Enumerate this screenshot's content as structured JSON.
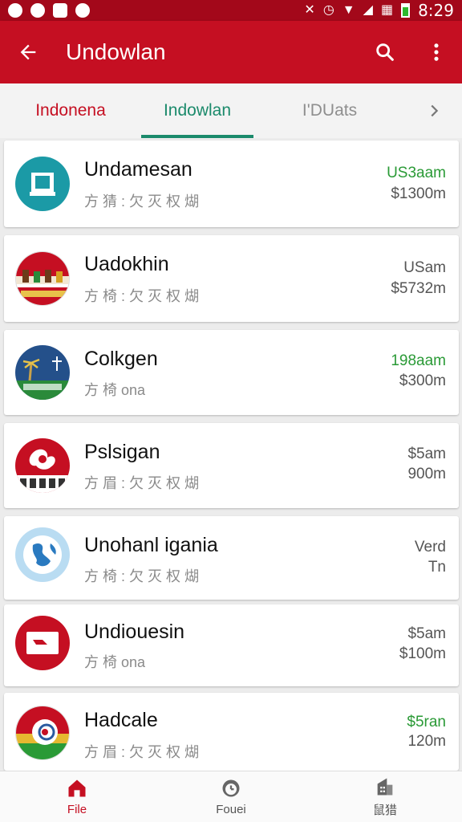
{
  "status_bar": {
    "time": "8:29",
    "left_icons": [
      "wechat-icon",
      "messenger-icon",
      "notification-icon",
      "whatsapp-icon"
    ],
    "right_icons": [
      "mute-icon",
      "alarm-icon",
      "wifi-icon",
      "signal-icon",
      "data-icon",
      "battery-icon"
    ]
  },
  "app_bar": {
    "title": "Undowlan",
    "back_icon": "arrow-left-icon",
    "search_icon": "search-icon",
    "menu_icon": "more-vertical-icon"
  },
  "tabs": {
    "items": [
      {
        "label": "Indonena"
      },
      {
        "label": "Indowlan"
      },
      {
        "label": "I'DUats"
      }
    ],
    "active_index": 1,
    "next_icon": "chevron-right-icon"
  },
  "items": [
    {
      "name": "Undamesan",
      "sub": "方 猜 : 欠 灭 权 煳",
      "price_top": "US3aam",
      "price_top_color": "#2a9a36",
      "price_bottom": "$1300m",
      "logo": "building-teal-logo"
    },
    {
      "name": "Uadokhin",
      "sub": "方 椅 : 欠 灭 权 煳",
      "price_top": "USam",
      "price_top_color": "#555555",
      "price_bottom": "$5732m",
      "logo": "red-parade-logo"
    },
    {
      "name": "Colkgen",
      "sub": "方 椅 ona",
      "price_top": "198aam",
      "price_top_color": "#2a9a36",
      "price_bottom": "$300m",
      "logo": "palm-island-logo"
    },
    {
      "name": "Pslsigan",
      "sub": "方 眉 : 欠 灭 权 煳",
      "price_top": "$5am",
      "price_top_color": "#555555",
      "price_bottom": "900m",
      "logo": "red-emblem-logo"
    },
    {
      "name": "Unohanl igania",
      "sub": "方 椅 : 欠 灭 权 煳",
      "price_top": "Verd",
      "price_top_color": "#555555",
      "price_bottom": "Tn",
      "logo": "globe-blue-logo"
    },
    {
      "name": "Undiouesin",
      "sub": "方 椅 ona",
      "price_top": "$5am",
      "price_top_color": "#555555",
      "price_bottom": "$100m",
      "logo": "red-screen-logo"
    },
    {
      "name": "Hadcale",
      "sub": "方 眉 : 欠 灭 权 煳",
      "price_top": "$5ran",
      "price_top_color": "#2a9a36",
      "price_bottom": "120m",
      "logo": "tricolor-ring-logo"
    }
  ],
  "bottom_nav": {
    "items": [
      {
        "label": "File",
        "icon": "home-icon"
      },
      {
        "label": "Fouei",
        "icon": "clock-icon"
      },
      {
        "label": "鼠猎",
        "icon": "building-icon"
      }
    ],
    "active_index": 0
  },
  "colors": {
    "primary": "#c50f22",
    "primary_dark": "#a3081a",
    "accent": "#1b8a6b",
    "price_green": "#2a9a36"
  }
}
